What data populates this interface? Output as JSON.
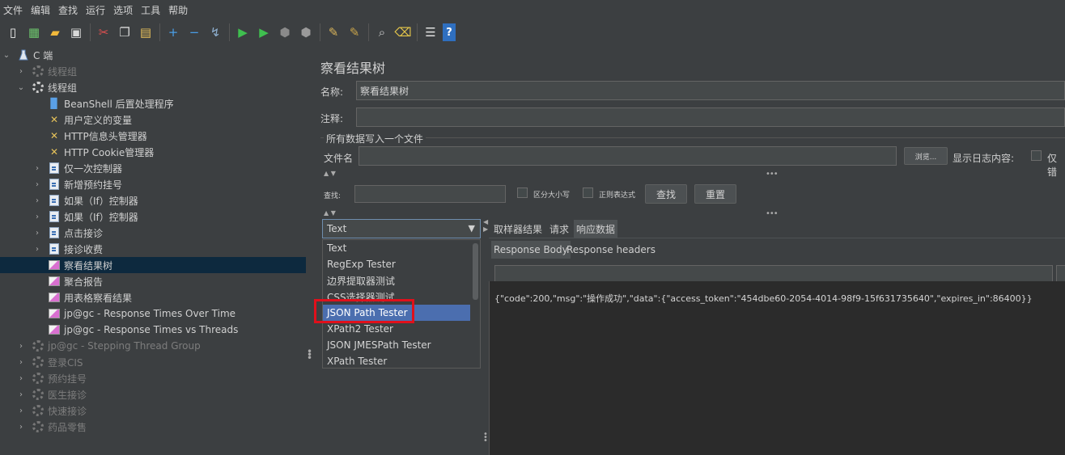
{
  "menu": [
    "文件",
    "编辑",
    "查找",
    "运行",
    "选项",
    "工具",
    "帮助"
  ],
  "toolbar_icons": [
    "new-icon",
    "templates-icon",
    "open-icon",
    "save-icon",
    "cut-icon",
    "copy-icon",
    "paste-icon",
    "expand-icon",
    "collapse-icon",
    "toggle-icon",
    "start-icon",
    "start-no-pause-icon",
    "stop-icon",
    "shutdown-icon",
    "clear-icon",
    "clear-all-icon",
    "search-icon",
    "reset-search-icon",
    "function-helper-icon",
    "help-icon"
  ],
  "tree": {
    "root": "C      端",
    "items": [
      {
        "label": "线程组",
        "icon": "gear-icon",
        "level": 1,
        "expander": "›",
        "dim": true
      },
      {
        "label": "线程组",
        "icon": "gear-icon",
        "level": 1,
        "expander": "⌄",
        "dim": false
      },
      {
        "label": "BeanShell 后置处理程序",
        "icon": "beanshell-icon",
        "level": 2,
        "expander": "",
        "dim": false
      },
      {
        "label": "用户定义的变量",
        "icon": "wrench-icon",
        "level": 2,
        "expander": "",
        "dim": false
      },
      {
        "label": "HTTP信息头管理器",
        "icon": "wrench-icon",
        "level": 2,
        "expander": "",
        "dim": false
      },
      {
        "label": "HTTP Cookie管理器",
        "icon": "wrench-icon",
        "level": 2,
        "expander": "",
        "dim": false
      },
      {
        "label": "仅一次控制器",
        "icon": "controller-icon",
        "level": 2,
        "expander": "›",
        "dim": false
      },
      {
        "label": "新增预约挂号",
        "icon": "controller-icon",
        "level": 2,
        "expander": "›",
        "dim": false
      },
      {
        "label": "如果（If）控制器",
        "icon": "controller-icon",
        "level": 2,
        "expander": "›",
        "dim": false
      },
      {
        "label": "如果（If）控制器",
        "icon": "controller-icon",
        "level": 2,
        "expander": "›",
        "dim": false
      },
      {
        "label": "点击接诊",
        "icon": "controller-icon",
        "level": 2,
        "expander": "›",
        "dim": false
      },
      {
        "label": "接诊收费",
        "icon": "controller-icon",
        "level": 2,
        "expander": "›",
        "dim": false
      },
      {
        "label": "察看结果树",
        "icon": "listener-icon",
        "level": 2,
        "expander": "",
        "dim": false,
        "selected": true
      },
      {
        "label": "聚合报告",
        "icon": "listener-icon",
        "level": 2,
        "expander": "",
        "dim": false
      },
      {
        "label": "用表格察看结果",
        "icon": "listener-icon",
        "level": 2,
        "expander": "",
        "dim": false
      },
      {
        "label": "jp@gc - Response Times Over Time",
        "icon": "listener-icon",
        "level": 2,
        "expander": "",
        "dim": false
      },
      {
        "label": "jp@gc - Response Times vs Threads",
        "icon": "listener-icon",
        "level": 2,
        "expander": "",
        "dim": false
      },
      {
        "label": "jp@gc - Stepping Thread Group",
        "icon": "gear-icon",
        "level": 1,
        "expander": "›",
        "dim": true
      },
      {
        "label": "登录CIS",
        "icon": "gear-icon",
        "level": 1,
        "expander": "›",
        "dim": true
      },
      {
        "label": "预约挂号",
        "icon": "gear-icon",
        "level": 1,
        "expander": "›",
        "dim": true
      },
      {
        "label": "医生接诊",
        "icon": "gear-icon",
        "level": 1,
        "expander": "›",
        "dim": true
      },
      {
        "label": "快速接诊",
        "icon": "gear-icon",
        "level": 1,
        "expander": "›",
        "dim": true
      },
      {
        "label": "药品零售",
        "icon": "gear-icon",
        "level": 1,
        "expander": "›",
        "dim": true
      }
    ]
  },
  "panel": {
    "title": "察看结果树",
    "name_label": "名称:",
    "name_value": "察看结果树",
    "comment_label": "注释:",
    "comment_value": "",
    "file_section": "所有数据写入一个文件",
    "file_label": "文件名",
    "file_value": "",
    "browse_label": "浏览...",
    "log_label": "显示日志内容:",
    "errors_only_label": "仅错",
    "search_label": "查找:",
    "search_value": "",
    "case_label": "区分大小写",
    "regex_label": "正则表达式",
    "find_button": "查找",
    "reset_button": "重置"
  },
  "renderer": {
    "selected": "Text",
    "options": [
      "Text",
      "RegExp Tester",
      "边界提取器测试",
      "CSS选择器测试",
      "JSON Path Tester",
      "XPath2 Tester",
      "JSON JMESPath Tester",
      "XPath Tester"
    ],
    "highlighted": "JSON Path Tester"
  },
  "result_tabs": [
    "取样器结果",
    "请求",
    "响应数据"
  ],
  "result_active_tab": "响应数据",
  "response_tabs": [
    "Response Body",
    "Response headers"
  ],
  "response_active_tab": "Response Body",
  "response_body": "{\"code\":200,\"msg\":\"操作成功\",\"data\":{\"access_token\":\"454dbe60-2054-4014-98f9-15f631735640\",\"expires_in\":86400}}"
}
